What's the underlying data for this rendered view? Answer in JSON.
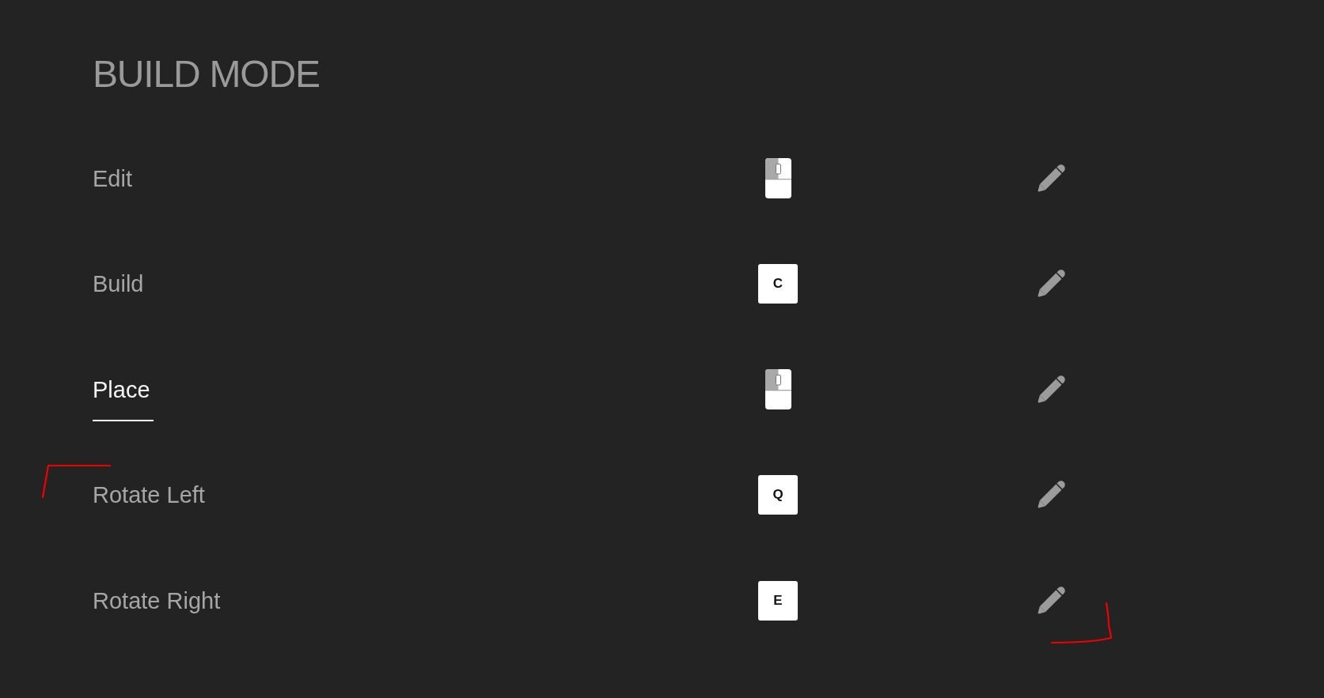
{
  "title": "BUILD MODE",
  "bindings": [
    {
      "action": "Edit",
      "selected": false,
      "input": {
        "kind": "mouse"
      }
    },
    {
      "action": "Build",
      "selected": false,
      "input": {
        "kind": "key",
        "key": "C"
      }
    },
    {
      "action": "Place",
      "selected": true,
      "input": {
        "kind": "mouse"
      }
    },
    {
      "action": "Rotate Left",
      "selected": false,
      "input": {
        "kind": "key",
        "key": "Q"
      }
    },
    {
      "action": "Rotate Right",
      "selected": false,
      "input": {
        "kind": "key",
        "key": "E"
      }
    }
  ]
}
